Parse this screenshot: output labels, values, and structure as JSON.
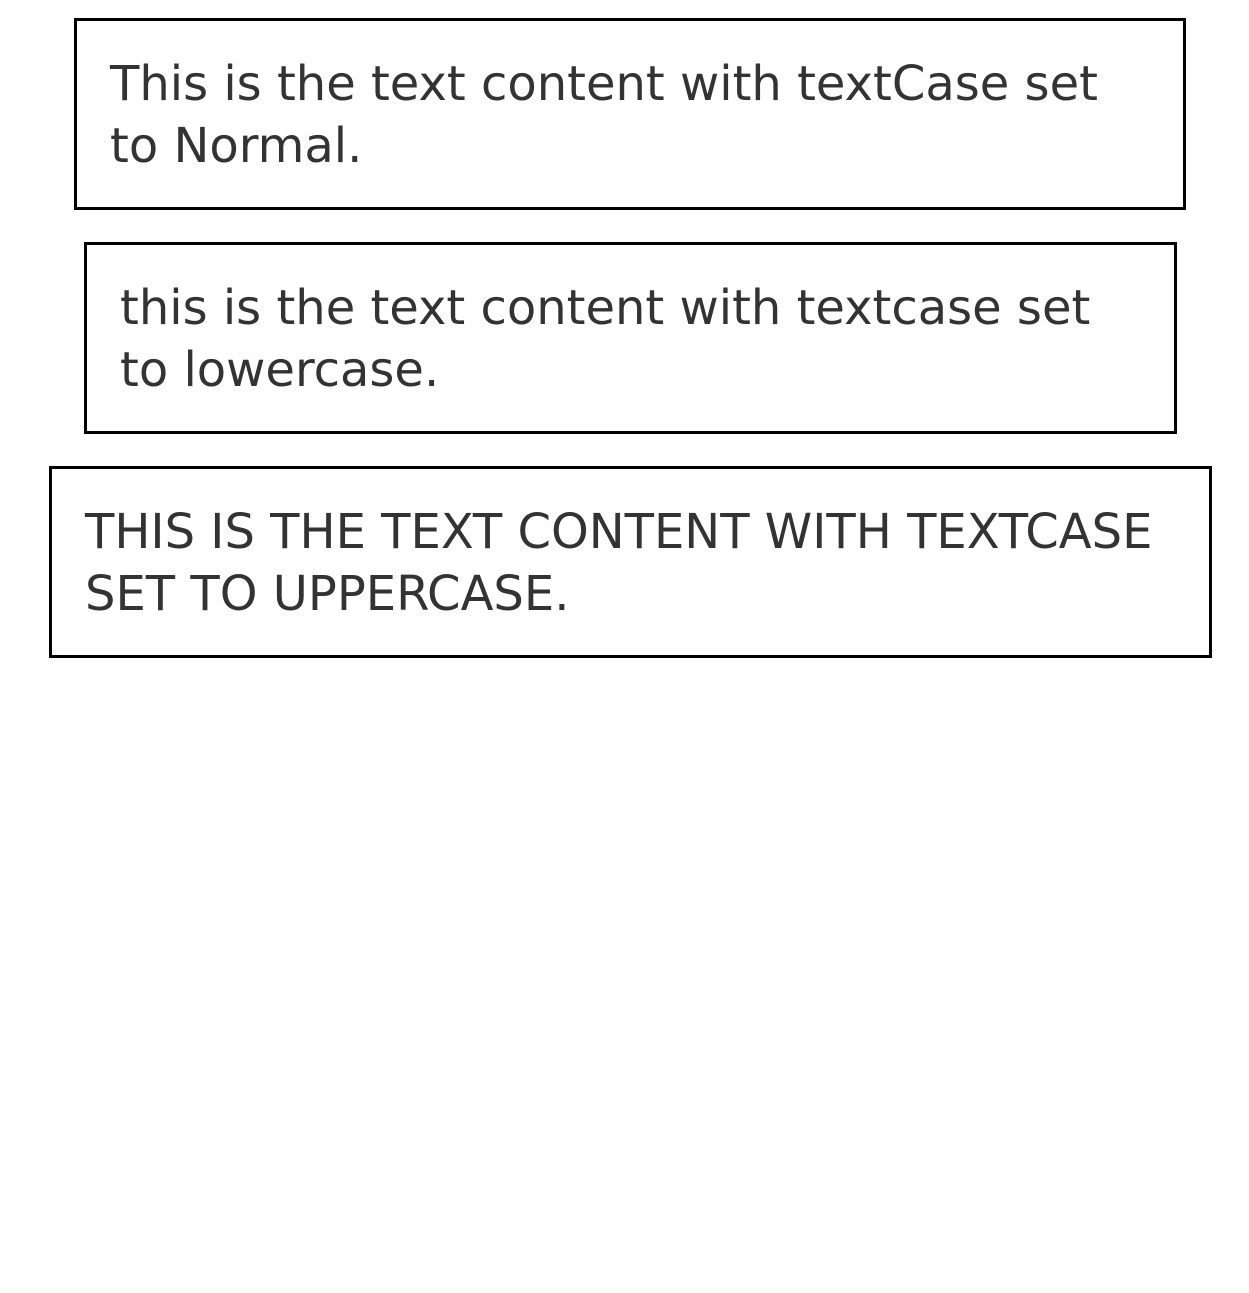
{
  "text_boxes": {
    "normal": "This is the text content with textCase set to Normal.",
    "lowercase": "this is the text content with textcase set to lowercase.",
    "uppercase": "THIS IS THE TEXT CONTENT WITH TEXTCASE SET TO UPPERCASE."
  },
  "colors": {
    "text": "#333333",
    "border": "#000000",
    "background": "#ffffff"
  }
}
